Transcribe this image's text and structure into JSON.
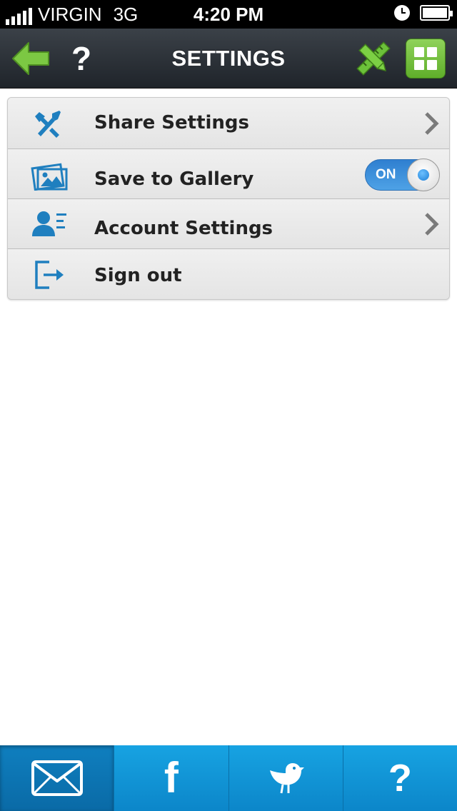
{
  "status_bar": {
    "carrier": "VIRGIN",
    "network": "3G",
    "time": "4:20 PM",
    "icons": [
      "signal-icon",
      "clock-icon",
      "battery-icon"
    ]
  },
  "nav": {
    "title": "SETTINGS",
    "help_label": "?",
    "icons": [
      "back-arrow-icon",
      "help-icon",
      "pencil-ruler-icon",
      "grid-icon"
    ],
    "accent_color": "#6cc13a"
  },
  "settings": {
    "items": [
      {
        "label": "Share Settings",
        "icon": "tools-icon",
        "accessory": "chevron"
      },
      {
        "label": "Save to Gallery",
        "icon": "gallery-icon",
        "accessory": "toggle",
        "toggle_label": "ON",
        "toggle_on": true
      },
      {
        "label": "Account Settings",
        "icon": "account-icon",
        "accessory": "chevron"
      },
      {
        "label": "Sign out",
        "icon": "sign-out-icon",
        "accessory": "none"
      }
    ],
    "icon_color": "#1f7fbf"
  },
  "tab_bar": {
    "tabs": [
      {
        "name": "mail",
        "icon": "envelope-icon",
        "active": true
      },
      {
        "name": "facebook",
        "icon": "facebook-icon",
        "glyph": "f",
        "active": false
      },
      {
        "name": "twitter",
        "icon": "twitter-bird-icon",
        "active": false
      },
      {
        "name": "help",
        "icon": "help-icon",
        "glyph": "?",
        "active": false
      }
    ],
    "color": "#1398d8"
  }
}
